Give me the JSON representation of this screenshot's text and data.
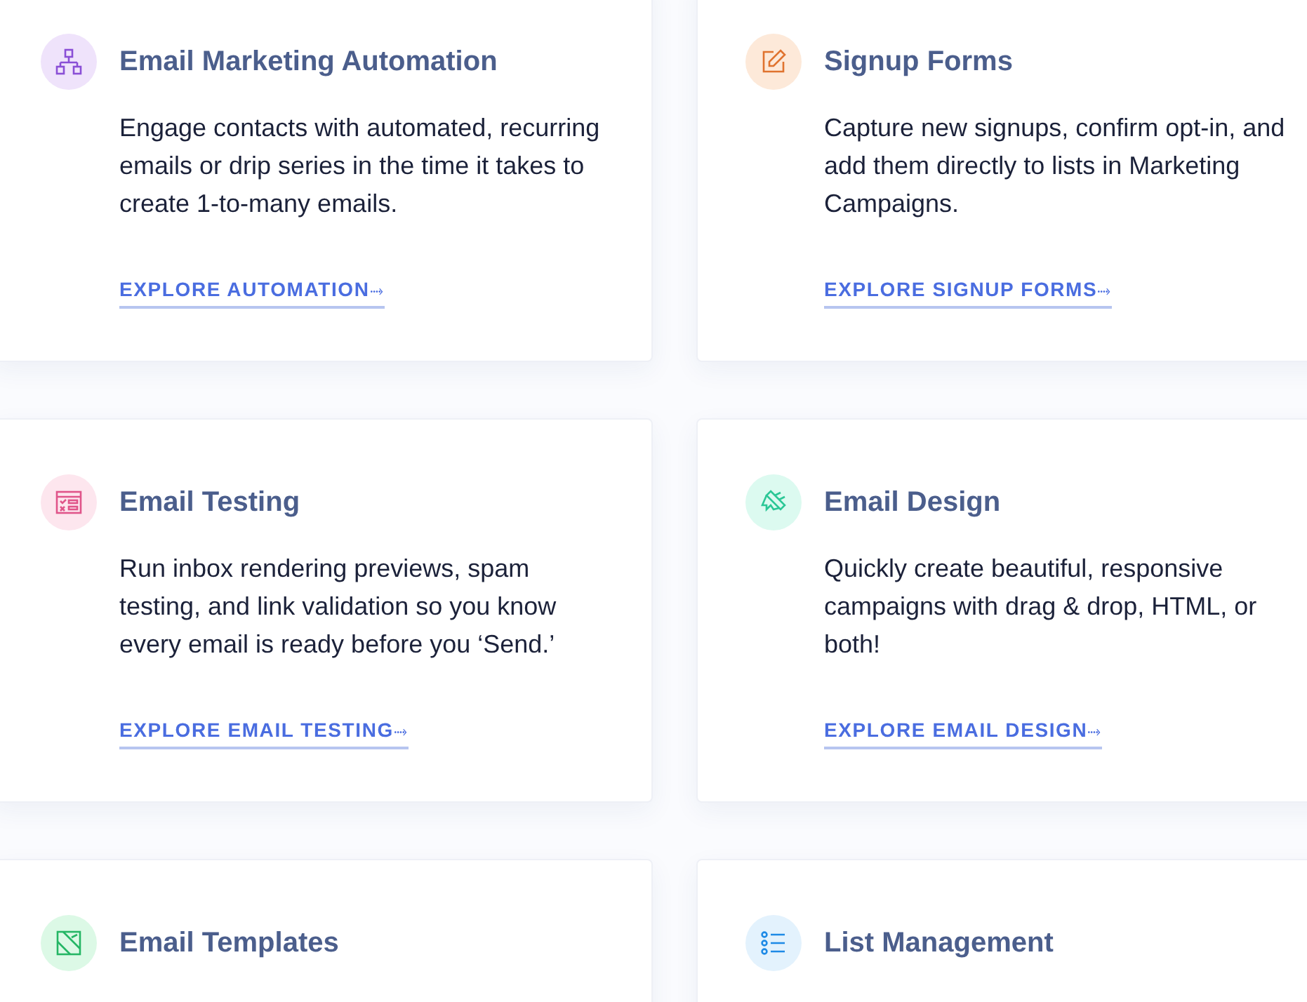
{
  "cards": [
    {
      "title": "Email Marketing Automation",
      "description": "Engage contacts with automated, recurring emails or drip series in the time it takes to create 1-to-many emails.",
      "link": "EXPLORE AUTOMATION",
      "arrow": "⤑"
    },
    {
      "title": "Signup Forms",
      "description": "Capture new signups, confirm opt-in, and add them directly to lists in Marketing Campaigns.",
      "link": "EXPLORE SIGNUP FORMS",
      "arrow": "⤑"
    },
    {
      "title": "Email Testing",
      "description": "Run inbox rendering previews, spam testing, and link validation so you know every email is ready before you ‘Send.’",
      "link": "EXPLORE EMAIL TESTING",
      "arrow": "⤑"
    },
    {
      "title": "Email Design",
      "description": "Quickly create beautiful, responsive campaigns with drag & drop, HTML, or both!",
      "link": "EXPLORE EMAIL DESIGN",
      "arrow": "⤑"
    },
    {
      "title": "Email Templates"
    },
    {
      "title": "List Management"
    }
  ]
}
